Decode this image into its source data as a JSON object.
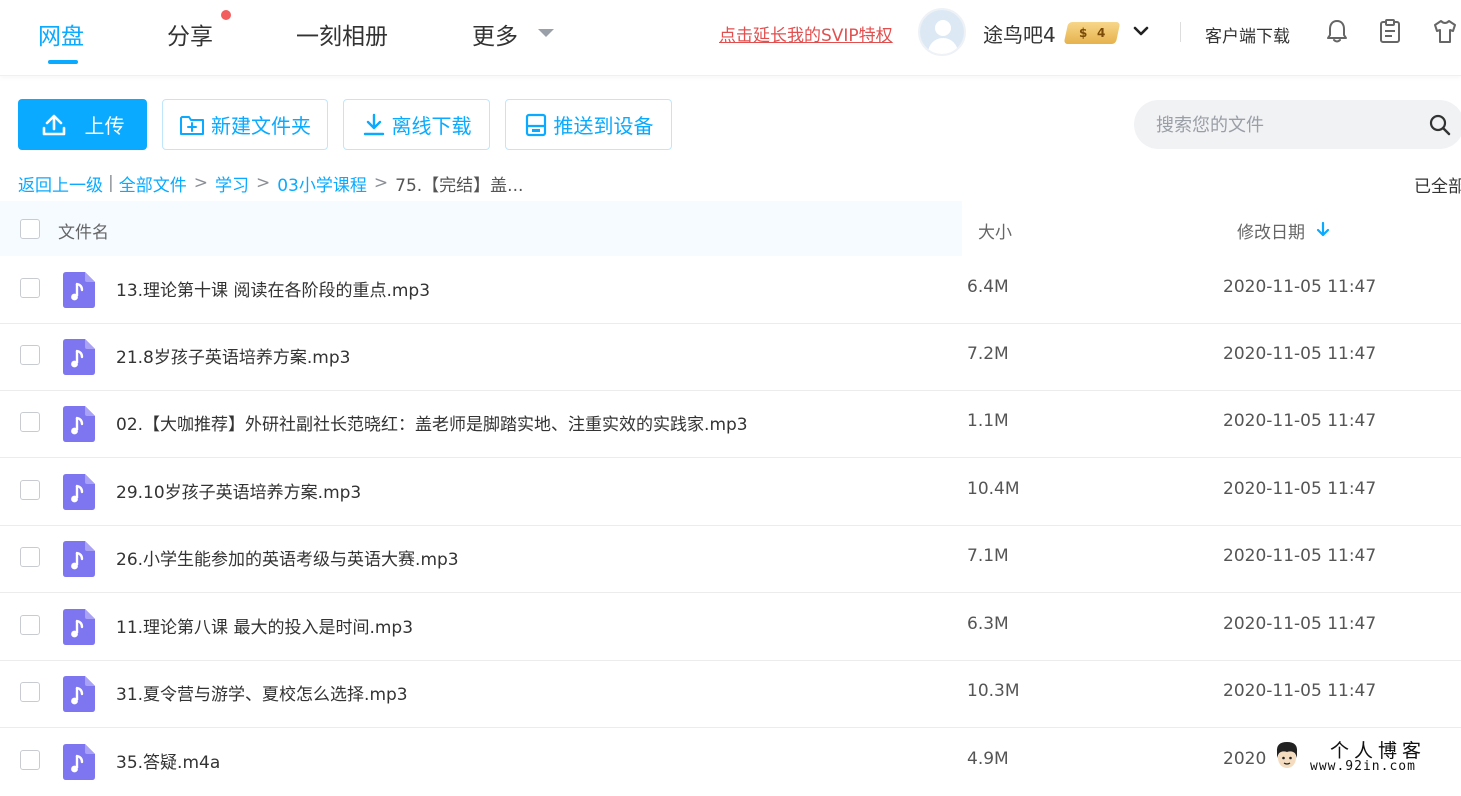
{
  "nav": {
    "items": [
      {
        "label": "网盘",
        "active": true
      },
      {
        "label": "分享",
        "has_notification": true
      },
      {
        "label": "一刻相册"
      },
      {
        "label": "更多"
      }
    ]
  },
  "header": {
    "svip_link": "点击延长我的SVIP特权",
    "username": "途鸟吧4",
    "vip_badge": {
      "coin": "$",
      "level": "4"
    },
    "client_download": "客户端下载",
    "icons": [
      "bell-icon",
      "clipboard-icon",
      "shirt-icon"
    ]
  },
  "toolbar": {
    "upload": "上传",
    "new_folder": "新建文件夹",
    "offline_download": "离线下载",
    "push_device": "推送到设备"
  },
  "search": {
    "placeholder": "搜索您的文件",
    "value": ""
  },
  "breadcrumb": {
    "back": "返回上一级",
    "items": [
      "全部文件",
      "学习",
      "03小学课程"
    ],
    "current": "75.【完结】盖...",
    "loaded_status": "已全部"
  },
  "table": {
    "columns": {
      "name": "文件名",
      "size": "大小",
      "date": "修改日期"
    },
    "sort": "date-desc",
    "rows": [
      {
        "name": "13.理论第十课 阅读在各阶段的重点.mp3",
        "size": "6.4M",
        "date": "2020-11-05 11:47"
      },
      {
        "name": "21.8岁孩子英语培养方案.mp3",
        "size": "7.2M",
        "date": "2020-11-05 11:47"
      },
      {
        "name": "02.【大咖推荐】外研社副社长范晓红：盖老师是脚踏实地、注重实效的实践家.mp3",
        "size": "1.1M",
        "date": "2020-11-05 11:47"
      },
      {
        "name": "29.10岁孩子英语培养方案.mp3",
        "size": "10.4M",
        "date": "2020-11-05 11:47"
      },
      {
        "name": "26.小学生能参加的英语考级与英语大赛.mp3",
        "size": "7.1M",
        "date": "2020-11-05 11:47"
      },
      {
        "name": "11.理论第八课 最大的投入是时间.mp3",
        "size": "6.3M",
        "date": "2020-11-05 11:47"
      },
      {
        "name": "31.夏令营与游学、夏校怎么选择.mp3",
        "size": "10.3M",
        "date": "2020-11-05 11:47"
      },
      {
        "name": "35.答疑.m4a",
        "size": "4.9M",
        "date": "2020"
      }
    ]
  },
  "watermark": {
    "title": "个人博客",
    "url": "www.92in.com"
  },
  "colors": {
    "accent": "#09aaff",
    "svip": "#e24f4f",
    "audio_icon": "#7e75f0",
    "notification_dot": "#f25d5d"
  }
}
